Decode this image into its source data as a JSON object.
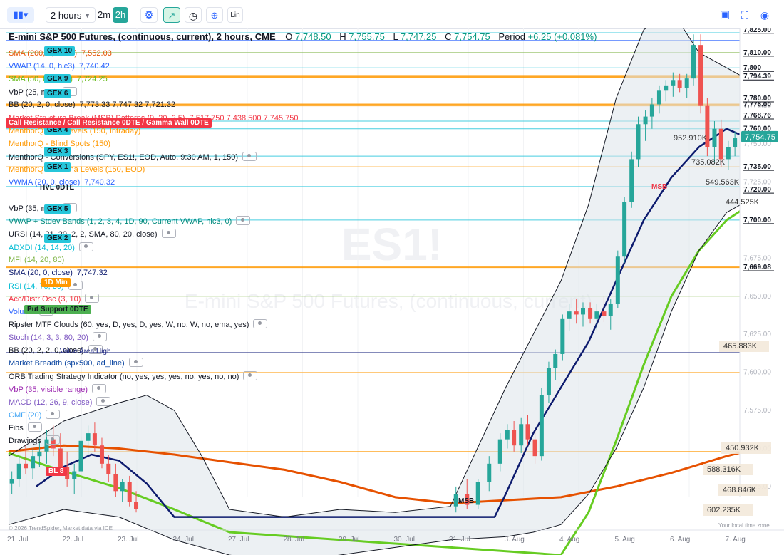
{
  "toolbar": {
    "interval": "2 hours",
    "tf_2m": "2m",
    "tf_2h": "2h",
    "lin": "Lin"
  },
  "header": {
    "symbol_title": "E-mini S&P 500 Futures, (continuous, current), 2 hours, CME",
    "o_label": "O",
    "o_value": "7,748.50",
    "h_label": "H",
    "h_value": "7,755.75",
    "l_label": "L",
    "l_value": "7,747.25",
    "c_label": "C",
    "c_value": "7,754.75",
    "period_label": "Period",
    "period_value": "+6.25 (+0.081%)"
  },
  "indicators": [
    {
      "label": "SMA (200, 0, close)",
      "value": "7,552.03",
      "color": "#e65100"
    },
    {
      "label": "VWAP (14, 0, hlc3)",
      "value": "7,740.42",
      "color": "#2962ff"
    },
    {
      "label": "SMA (50, 0, close)",
      "value": "7,724.25",
      "color": "#66bb1a"
    },
    {
      "label": "VbP (25, max)",
      "value": "",
      "color": "#131722"
    },
    {
      "label": "BB (20, 2, 0, close)",
      "value": "7,773.33  7,747.32  7,721.32",
      "color": "#131722"
    },
    {
      "label": "Market Structure Break (MSB) Patterns (9, 20, 2.5)",
      "value": "7,517.750  7,438.500  7,745.750",
      "color": "#f23645"
    },
    {
      "label": "MenthorQ - Net Levels (150, Intraday)",
      "value": "",
      "color": "#ff9800"
    },
    {
      "label": "MenthorQ - Blind Spots (150)",
      "value": "",
      "color": "#ff9800"
    },
    {
      "label": "MenthorQ - Conversions (SPY, ES1!, EOD, Auto, 9:30 AM, 1, 150)",
      "value": "",
      "color": "#131722"
    },
    {
      "label": "MenthorQ - Gamma Levels (150, EOD)",
      "value": "",
      "color": "#ff9800"
    },
    {
      "label": "VWMA (20, 0, close)",
      "value": "7,740.32",
      "color": "#2962ff"
    },
    {
      "label": "",
      "value": "",
      "color": "#131722"
    },
    {
      "label": "VbP (35, max)",
      "value": "",
      "color": "#131722"
    },
    {
      "label": "VWAP + Stdev Bands (1, 2, 3, 4, 1D, 90, Current VWAP, hlc3, 0)",
      "value": "",
      "color": "#00897b"
    },
    {
      "label": "URSI (14, 21, 20, 2, 2, SMA, 80, 20, close)",
      "value": "",
      "color": "#131722"
    },
    {
      "label": "ADXDI (14, 14, 20)",
      "value": "",
      "color": "#00bcd4"
    },
    {
      "label": "MFI (14, 20, 80)",
      "value": "",
      "color": "#7cb342"
    },
    {
      "label": "SMA (20, 0, close)",
      "value": "7,747.32",
      "color": "#0d1b6e"
    },
    {
      "label": "RSI (14, 70, 30)",
      "value": "",
      "color": "#00bcd4"
    },
    {
      "label": "Acc/Distr Osc (3, 10)",
      "value": "",
      "color": "#f23645"
    },
    {
      "label": "Volume",
      "value": "",
      "color": "#2962ff"
    },
    {
      "label": "Ripster MTF Clouds (60, yes, D, yes, D, yes, W, no, W, no, ema, yes)",
      "value": "",
      "color": "#131722"
    },
    {
      "label": "Stoch (14, 3, 3, 80, 20)",
      "value": "",
      "color": "#7e57c2"
    },
    {
      "label": "BB (20, 2, 2, 0, close)",
      "value": "",
      "color": "#131722"
    },
    {
      "label": "Market Breadth (spx500, ad_line)",
      "value": "",
      "color": "#0d47a1"
    },
    {
      "label": "ORB Trading Strategy Indicator (no, yes, yes, yes, no, yes, no, no)",
      "value": "",
      "color": "#131722"
    },
    {
      "label": "VbP (35, visible range)",
      "value": "",
      "color": "#9c27b0"
    },
    {
      "label": "MACD (12, 26, 9, close)",
      "value": "",
      "color": "#7e57c2"
    },
    {
      "label": "CMF (20)",
      "value": "",
      "color": "#42a5f5"
    },
    {
      "label": "Fibs",
      "value": "",
      "color": "#131722"
    },
    {
      "label": "Drawings",
      "value": "",
      "color": "#131722"
    }
  ],
  "tags": {
    "gex10": "GEX 10",
    "gex9": "GEX 9",
    "gex6": "GEX 6",
    "gex4": "GEX 4",
    "gex3": "GEX 3",
    "gex1": "GEX 1",
    "gex5": "GEX 5",
    "gex2": "GEX 2",
    "hvl": "HVL 0DTE",
    "call_res": "Call Resistance / Call Resistance 0DTE / Gamma Wall 0DTE",
    "min1d": "1D Min",
    "put_support": "Put Support 0DTE",
    "bl8": "BL 8",
    "value_area_high": "Value Area High",
    "msb1": "MSB",
    "msb2": "MSB"
  },
  "watermark": {
    "symbol": "ES1!",
    "name": "E-mini S&P 500 Futures, (continuous, current)"
  },
  "vbp_labels": [
    "952.910K",
    "735.082K",
    "549.563K",
    "444.525K",
    "465.883K",
    "450.932K",
    "588.316K",
    "468.846K",
    "602.235K"
  ],
  "price_labels": [
    {
      "text": "7,825.00",
      "price": 7825,
      "style": "line"
    },
    {
      "text": "7,810.00",
      "price": 7810,
      "style": "line"
    },
    {
      "text": "7,800",
      "price": 7800,
      "style": "line"
    },
    {
      "text": "7,794.39",
      "price": 7794.39,
      "style": "line"
    },
    {
      "text": "7,780.00",
      "price": 7780,
      "style": "line"
    },
    {
      "text": "7,776.00",
      "price": 7776,
      "style": "line"
    },
    {
      "text": "7,768.76",
      "price": 7768.76,
      "style": "line"
    },
    {
      "text": "7,760.00",
      "price": 7760,
      "style": "line"
    },
    {
      "text": "7,735.00",
      "price": 7735,
      "style": "line"
    },
    {
      "text": "7,720.00",
      "price": 7720,
      "style": "line"
    },
    {
      "text": "7,700.00",
      "price": 7700,
      "style": "line"
    },
    {
      "text": "7,669.08",
      "price": 7669.08,
      "style": "line"
    }
  ],
  "price_ticks": [
    "7,775.00",
    "7,750.00",
    "7,725.00",
    "7,700.00",
    "7,675.00",
    "7,650.00",
    "7,625.00",
    "7,600.00",
    "7,575.00",
    "7,550.00",
    "7,525.00"
  ],
  "current_price": "7,754.75",
  "footer": {
    "copyright": "© 2026 TrendSpider, Market data via ICE",
    "timezone": "Your local time zone"
  },
  "chart_data": {
    "type": "candlestick",
    "title": "E-mini S&P 500 Futures, (continuous, current), 2 hours, CME",
    "x_categories": [
      "21. Jul",
      "22. Jul",
      "23. Jul",
      "24. Jul",
      "27. Jul",
      "28. Jul",
      "29. Jul",
      "30. Jul",
      "31. Jul",
      "3. Aug",
      "4. Aug",
      "5. Aug",
      "6. Aug",
      "7. Aug"
    ],
    "ylim": [
      7517,
      7838
    ],
    "y_ticks": [
      7775,
      7750,
      7725,
      7700,
      7675,
      7650,
      7625,
      7600,
      7575,
      7550,
      7525
    ],
    "candles": [
      {
        "x": 0.06,
        "o": 7527,
        "h": 7535,
        "l": 7520,
        "c": 7530
      },
      {
        "x": 0.19,
        "o": 7530,
        "h": 7545,
        "l": 7525,
        "c": 7540
      },
      {
        "x": 0.31,
        "o": 7540,
        "h": 7552,
        "l": 7533,
        "c": 7537
      },
      {
        "x": 0.44,
        "o": 7537,
        "h": 7550,
        "l": 7530,
        "c": 7545
      },
      {
        "x": 0.56,
        "o": 7545,
        "h": 7555,
        "l": 7538,
        "c": 7548
      },
      {
        "x": 0.69,
        "o": 7548,
        "h": 7562,
        "l": 7540,
        "c": 7556
      },
      {
        "x": 0.81,
        "o": 7556,
        "h": 7565,
        "l": 7545,
        "c": 7550
      },
      {
        "x": 0.94,
        "o": 7550,
        "h": 7560,
        "l": 7535,
        "c": 7538
      },
      {
        "x": 1.06,
        "o": 7538,
        "h": 7548,
        "l": 7525,
        "c": 7530
      },
      {
        "x": 1.19,
        "o": 7530,
        "h": 7540,
        "l": 7520,
        "c": 7535
      },
      {
        "x": 1.31,
        "o": 7535,
        "h": 7558,
        "l": 7530,
        "c": 7555
      },
      {
        "x": 1.44,
        "o": 7555,
        "h": 7565,
        "l": 7545,
        "c": 7560
      },
      {
        "x": 1.56,
        "o": 7560,
        "h": 7567,
        "l": 7548,
        "c": 7552
      },
      {
        "x": 1.69,
        "o": 7552,
        "h": 7557,
        "l": 7537,
        "c": 7540
      },
      {
        "x": 1.81,
        "o": 7540,
        "h": 7546,
        "l": 7528,
        "c": 7533
      },
      {
        "x": 1.94,
        "o": 7533,
        "h": 7540,
        "l": 7518,
        "c": 7522
      },
      {
        "x": 2.06,
        "o": 7522,
        "h": 7530,
        "l": 7515,
        "c": 7528
      },
      {
        "x": 2.19,
        "o": 7528,
        "h": 7532,
        "l": 7512,
        "c": 7515
      },
      {
        "x": 2.31,
        "o": 7515,
        "h": 7522,
        "l": 7508,
        "c": 7510
      },
      {
        "x": 8.1,
        "o": 7512,
        "h": 7525,
        "l": 7508,
        "c": 7520
      },
      {
        "x": 8.3,
        "o": 7520,
        "h": 7530,
        "l": 7510,
        "c": 7513
      },
      {
        "x": 8.5,
        "o": 7513,
        "h": 7530,
        "l": 7510,
        "c": 7528
      },
      {
        "x": 8.7,
        "o": 7528,
        "h": 7545,
        "l": 7522,
        "c": 7540
      },
      {
        "x": 8.9,
        "o": 7540,
        "h": 7560,
        "l": 7535,
        "c": 7556
      },
      {
        "x": 9.03,
        "o": 7556,
        "h": 7566,
        "l": 7550,
        "c": 7562
      },
      {
        "x": 9.15,
        "o": 7562,
        "h": 7568,
        "l": 7548,
        "c": 7552
      },
      {
        "x": 9.28,
        "o": 7552,
        "h": 7570,
        "l": 7547,
        "c": 7566
      },
      {
        "x": 9.4,
        "o": 7566,
        "h": 7572,
        "l": 7552,
        "c": 7556
      },
      {
        "x": 9.53,
        "o": 7556,
        "h": 7562,
        "l": 7540,
        "c": 7545
      },
      {
        "x": 9.65,
        "o": 7545,
        "h": 7590,
        "l": 7542,
        "c": 7585
      },
      {
        "x": 9.78,
        "o": 7585,
        "h": 7607,
        "l": 7580,
        "c": 7603
      },
      {
        "x": 9.9,
        "o": 7603,
        "h": 7615,
        "l": 7595,
        "c": 7612
      },
      {
        "x": 10.03,
        "o": 7612,
        "h": 7638,
        "l": 7608,
        "c": 7635
      },
      {
        "x": 10.15,
        "o": 7635,
        "h": 7645,
        "l": 7627,
        "c": 7640
      },
      {
        "x": 10.28,
        "o": 7640,
        "h": 7648,
        "l": 7632,
        "c": 7638
      },
      {
        "x": 10.4,
        "o": 7638,
        "h": 7646,
        "l": 7630,
        "c": 7642
      },
      {
        "x": 10.53,
        "o": 7642,
        "h": 7646,
        "l": 7632,
        "c": 7635
      },
      {
        "x": 10.65,
        "o": 7635,
        "h": 7645,
        "l": 7628,
        "c": 7640
      },
      {
        "x": 10.78,
        "o": 7640,
        "h": 7650,
        "l": 7633,
        "c": 7637
      },
      {
        "x": 10.9,
        "o": 7637,
        "h": 7648,
        "l": 7628,
        "c": 7645
      },
      {
        "x": 11.03,
        "o": 7645,
        "h": 7680,
        "l": 7642,
        "c": 7676
      },
      {
        "x": 11.15,
        "o": 7676,
        "h": 7715,
        "l": 7672,
        "c": 7712
      },
      {
        "x": 11.28,
        "o": 7712,
        "h": 7745,
        "l": 7708,
        "c": 7740
      },
      {
        "x": 11.4,
        "o": 7740,
        "h": 7768,
        "l": 7735,
        "c": 7763
      },
      {
        "x": 11.53,
        "o": 7763,
        "h": 7772,
        "l": 7752,
        "c": 7768
      },
      {
        "x": 11.65,
        "o": 7768,
        "h": 7780,
        "l": 7760,
        "c": 7776
      },
      {
        "x": 11.78,
        "o": 7776,
        "h": 7788,
        "l": 7770,
        "c": 7785
      },
      {
        "x": 11.9,
        "o": 7785,
        "h": 7792,
        "l": 7778,
        "c": 7788
      },
      {
        "x": 12.03,
        "o": 7788,
        "h": 7797,
        "l": 7781,
        "c": 7792
      },
      {
        "x": 12.15,
        "o": 7792,
        "h": 7796,
        "l": 7784,
        "c": 7787
      },
      {
        "x": 12.28,
        "o": 7787,
        "h": 7796,
        "l": 7780,
        "c": 7793
      },
      {
        "x": 12.4,
        "o": 7793,
        "h": 7822,
        "l": 7788,
        "c": 7815
      },
      {
        "x": 12.53,
        "o": 7815,
        "h": 7822,
        "l": 7770,
        "c": 7775
      },
      {
        "x": 12.65,
        "o": 7775,
        "h": 7780,
        "l": 7742,
        "c": 7748
      },
      {
        "x": 12.78,
        "o": 7748,
        "h": 7765,
        "l": 7738,
        "c": 7760
      },
      {
        "x": 12.9,
        "o": 7760,
        "h": 7766,
        "l": 7735,
        "c": 7740
      },
      {
        "x": 13.03,
        "o": 7740,
        "h": 7752,
        "l": 7733,
        "c": 7748
      },
      {
        "x": 13.15,
        "o": 7748,
        "h": 7758,
        "l": 7742,
        "c": 7754
      },
      {
        "x": 13.28,
        "o": 7754,
        "h": 7762,
        "l": 7745,
        "c": 7750
      },
      {
        "x": 13.4,
        "o": 7750,
        "h": 7753,
        "l": 7722,
        "c": 7726
      },
      {
        "x": 13.53,
        "o": 7726,
        "h": 7735,
        "l": 7718,
        "c": 7730
      },
      {
        "x": 13.65,
        "o": 7730,
        "h": 7738,
        "l": 7722,
        "c": 7725
      },
      {
        "x": 13.78,
        "o": 7725,
        "h": 7736,
        "l": 7720,
        "c": 7732
      },
      {
        "x": 13.9,
        "o": 7732,
        "h": 7756,
        "l": 7728,
        "c": 7749
      },
      {
        "x": 14.03,
        "o": 7748.5,
        "h": 7755.75,
        "l": 7747.25,
        "c": 7754.75
      }
    ],
    "series": [
      {
        "name": "SMA (200, 0, close)",
        "color": "#e65100",
        "x": [
          0,
          1,
          2,
          3,
          4,
          5,
          6,
          7,
          8,
          9,
          10,
          11,
          12,
          13,
          14.1
        ],
        "y": [
          7548,
          7552,
          7550,
          7546,
          7541,
          7536,
          7528,
          7518,
          7514,
          7516,
          7518,
          7525,
          7534,
          7545,
          7555
        ]
      },
      {
        "name": "SMA (50, 0, close)",
        "color": "#66cc22",
        "x": [
          0,
          1,
          2,
          3,
          4,
          10,
          10.5,
          11,
          11.5,
          12,
          12.5,
          13,
          13.5,
          14.1
        ],
        "y": [
          7547,
          7535,
          7524,
          7510,
          7495,
          7480,
          7508,
          7555,
          7605,
          7650,
          7680,
          7700,
          7712,
          7722
        ]
      },
      {
        "name": "SMA (20, 0, close)",
        "color": "#0d1b6e",
        "x": [
          0.5,
          1,
          1.5,
          2,
          2.5,
          3,
          8.8,
          9,
          9.5,
          10,
          10.5,
          11,
          11.5,
          12,
          12.5,
          13,
          13.5,
          14.1
        ],
        "y": [
          7525,
          7538,
          7546,
          7542,
          7527,
          7505,
          7505,
          7520,
          7560,
          7590,
          7620,
          7660,
          7700,
          7728,
          7748,
          7760,
          7752,
          7747
        ]
      },
      {
        "name": "BB (20, 2, 0, close) upper",
        "color": "#131722",
        "x": [
          0,
          1,
          2,
          2.5,
          3,
          3.5,
          4,
          5,
          6,
          7,
          8,
          9,
          9.5,
          10,
          10.5,
          11,
          11.5,
          12,
          12.5,
          13,
          13.5,
          14.1
        ],
        "y": [
          7545,
          7568,
          7580,
          7585,
          7575,
          7545,
          7510,
          7505,
          7510,
          7508,
          7512,
          7590,
          7625,
          7660,
          7710,
          7780,
          7825,
          7838,
          7810,
          7800,
          7790,
          7773
        ]
      },
      {
        "name": "BB (20, 2, 0, close) lower",
        "color": "#131722",
        "x": [
          0,
          1,
          2,
          3,
          4,
          5,
          6,
          7,
          8,
          9,
          9.5,
          10,
          10.5,
          11,
          11.5,
          12,
          12.5,
          13,
          13.5,
          14.1
        ],
        "y": [
          7500,
          7510,
          7505,
          7490,
          7480,
          7475,
          7480,
          7485,
          7490,
          7492,
          7495,
          7500,
          7520,
          7550,
          7590,
          7640,
          7680,
          7705,
          7715,
          7721
        ]
      }
    ]
  }
}
